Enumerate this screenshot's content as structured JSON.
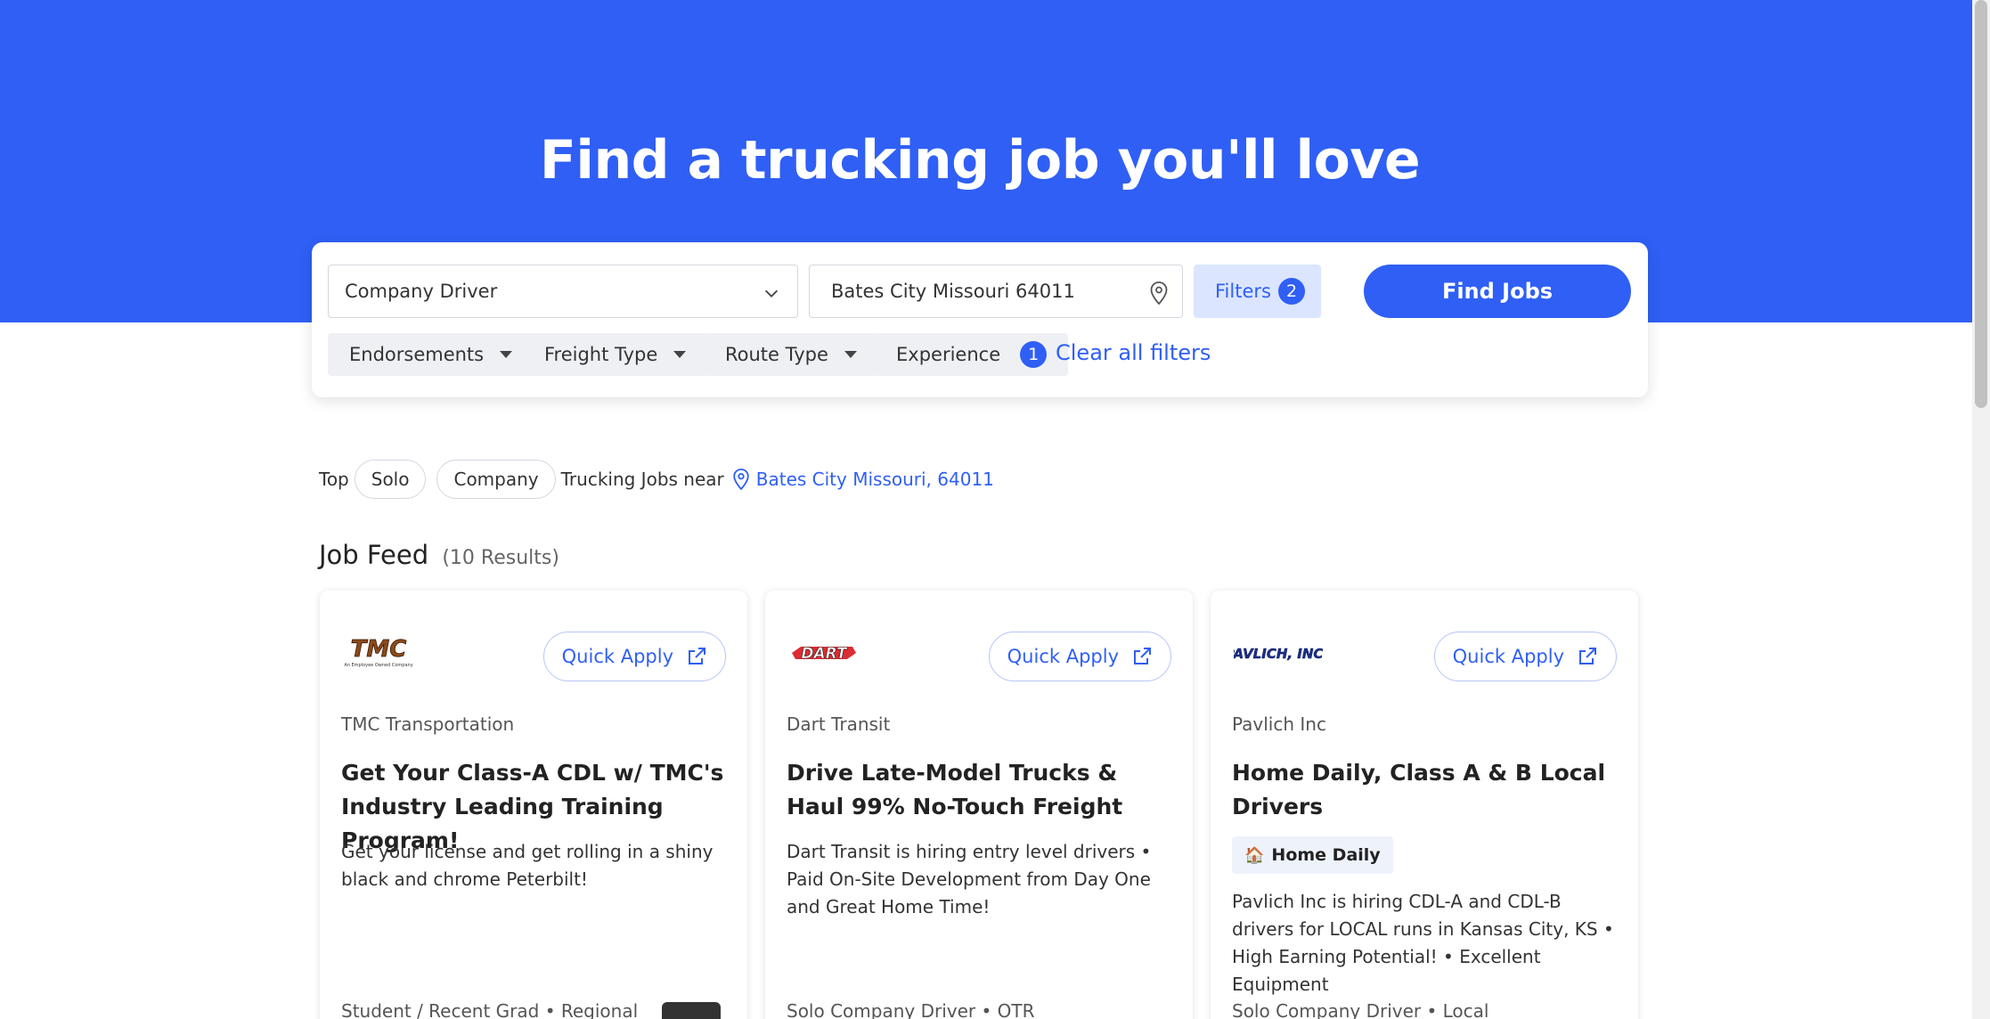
{
  "hero": {
    "title": "Find a trucking job you'll love"
  },
  "search": {
    "job_type": "Company Driver",
    "location": "Bates City Missouri 64011",
    "filters_label": "Filters",
    "filters_count": "2",
    "find_jobs_label": "Find Jobs"
  },
  "filter_chips": [
    {
      "label": "Endorsements"
    },
    {
      "label": "Freight Type"
    },
    {
      "label": "Route Type"
    },
    {
      "label": "Experience",
      "count": "1"
    }
  ],
  "clear_filters": "Clear all filters",
  "top_line": {
    "prefix": "Top",
    "pill1": "Solo",
    "pill2": "Company",
    "middle": "Trucking Jobs near",
    "location": "Bates City Missouri, 64011"
  },
  "feed": {
    "title": "Job Feed",
    "count": "(10 Results)"
  },
  "jobs": [
    {
      "logo_text": "TMC",
      "logo_subtext": "An Employee Owned Company",
      "quick_apply": "Quick Apply",
      "company": "TMC Transportation",
      "title": "Get Your Class-A CDL w/ TMC's Industry Leading Training Program!",
      "description": "Get your license and get rolling in a shiny black and chrome Peterbilt!",
      "meta": "Student / Recent Grad  •  Regional"
    },
    {
      "logo_text": "DART",
      "quick_apply": "Quick Apply",
      "company": "Dart Transit",
      "title": "Drive Late-Model Trucks & Haul 99% No-Touch Freight",
      "description": "Dart Transit is hiring entry level drivers • Paid On-Site Development from Day One and Great Home Time!",
      "meta": "Solo Company Driver  •  OTR"
    },
    {
      "logo_text": "PAVLICH, INC.",
      "quick_apply": "Quick Apply",
      "company": "Pavlich Inc",
      "title": "Home Daily, Class A & B Local Drivers",
      "tag": "Home Daily",
      "description": "Pavlich Inc is hiring CDL-A and CDL-B drivers for LOCAL runs in Kansas City, KS • High Earning Potential! • Excellent Equipment",
      "meta": "Solo Company Driver  •  Local"
    }
  ],
  "colors": {
    "brand": "#2f5ff5",
    "pill_bg": "#dbe5ff"
  },
  "icons": [
    "chevron-down-icon",
    "map-pin-icon",
    "external-link-icon",
    "caret-down-icon",
    "house-icon"
  ]
}
